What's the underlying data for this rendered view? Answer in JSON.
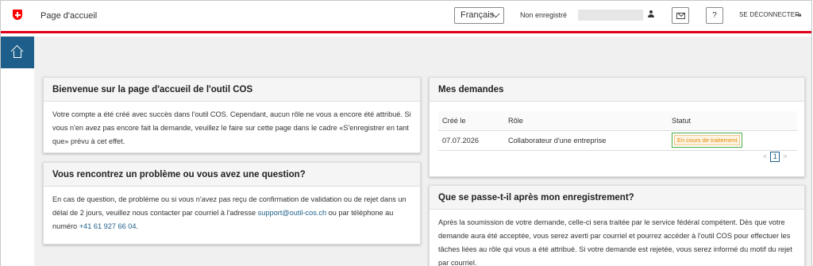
{
  "header": {
    "title": "Page d'accueil",
    "language": "Français",
    "status": "Non enregistré",
    "help_label": "?",
    "logout_label": "SE DÉCONNECTER",
    "logout_icon": "⇥"
  },
  "colors": {
    "accent_red": "#dc0018",
    "nav_blue": "#1d5f8a",
    "badge_orange": "#e08a00",
    "highlight_green": "#4cae4c"
  },
  "welcome": {
    "title": "Bienvenue sur la page d'accueil de l'outil COS",
    "body": "Votre compte a été créé avec succès dans l'outil COS. Cependant, aucun rôle ne vous a encore été attribué. Si vous n'en avez pas encore fait la demande, veuillez le faire sur cette page dans le cadre «S'enregistrer en tant que» prévu à cet effet."
  },
  "problem": {
    "title": "Vous rencontrez un problème ou vous avez une question?",
    "body_before": "En cas de question, de problème ou si vous n'avez pas reçu de confirmation de validation ou de rejet dans un délai de 2 jours, veuillez nous contacter par courriel à l'adresse ",
    "email": "support@outil-cos.ch",
    "body_middle": " ou par téléphone au numéro ",
    "phone": "+41 61 927 66 04",
    "body_after": "."
  },
  "requests": {
    "title": "Mes demandes",
    "columns": [
      "Créé le",
      "Rôle",
      "Statut"
    ],
    "rows": [
      {
        "created": "07.07.2026",
        "role": "Collaborateur d'une entreprise",
        "status": "En cours de traitement"
      }
    ],
    "pager": {
      "prev": "<",
      "page": "1",
      "next": ">"
    }
  },
  "after": {
    "title": "Que se passe-t-il après mon enregistrement?",
    "body": "Après la soumission de votre demande, celle-ci sera traitée par le service fédéral compétent. Dès que votre demande aura été acceptée, vous serez averti par courriel et pourrez accéder à l'outil COS pour effectuer les tâches liées au rôle qui vous a été attribué. Si votre demande est rejetée, vous serez informé du motif du rejet par courriel."
  }
}
